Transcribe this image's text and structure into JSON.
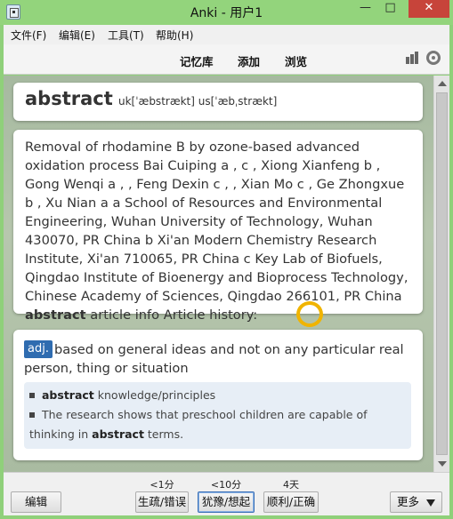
{
  "window": {
    "title": "Anki - 用户1",
    "minimize_glyph": "—",
    "maximize_glyph": "□",
    "close_glyph": "✕"
  },
  "menu": {
    "file": "文件(F)",
    "edit": "编辑(E)",
    "tools": "工具(T)",
    "help": "帮助(H)"
  },
  "toolbar": {
    "decks": "记忆库",
    "add": "添加",
    "browse": "浏览",
    "stats_icon": "bar-chart-icon",
    "sync_icon": "sync-icon"
  },
  "card": {
    "word": "abstract",
    "phonetic": "uk[ˈæbstrækt] us[ˈæbˌstrækt]",
    "context_before": "Removal of rhodamine B by ozone-based advanced oxidation process Bai Cuiping a , c , Xiong Xianfeng b , Gong Wenqi a ,  , Feng Dexin c ,  , Xian Mo c , Ge Zhongxue b , Xu Nian a a School of Resources and Environmental Engineering, Wuhan University of Technology, Wuhan 430070, PR China b Xi'an Modern Chemistry Research Institute, Xi'an 710065, PR China c Key Lab of Biofuels, Qingdao Institute of Bioenergy and Bioprocess Technology, Chinese Academy of Sciences, Qingdao 266101, PR China",
    "context_bold": "abstract",
    "context_after": " article info Article history:",
    "pos": "adj.",
    "definition": "based on general ideas and not on any particular real person, thing or situation",
    "examples": [
      {
        "bold": "abstract",
        "rest": " knowledge/principles"
      },
      {
        "pre": "The research shows that preschool children are capable of thinking in ",
        "bold": "abstract",
        "post": " terms."
      }
    ]
  },
  "bottom": {
    "edit": "编辑",
    "again_ivl": "<1分",
    "again": "生疏/错误",
    "hard_ivl": "<10分",
    "hard": "犹豫/想起",
    "good_ivl": "4天",
    "good": "顺利/正确",
    "more": "更多"
  }
}
